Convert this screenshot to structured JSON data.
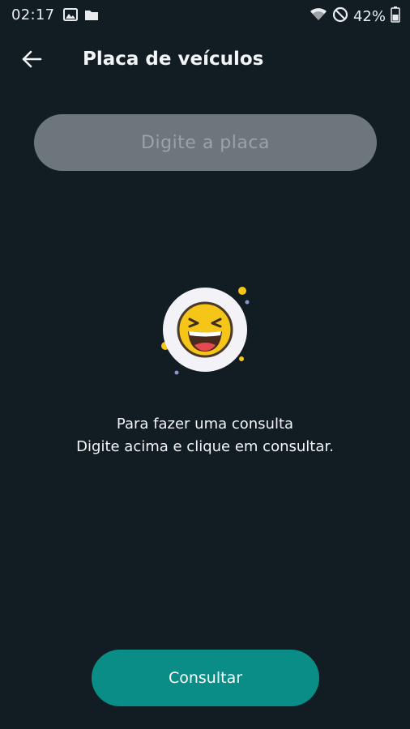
{
  "status_bar": {
    "time": "02:17",
    "battery": "42%",
    "icons": [
      "image-icon",
      "folder-icon",
      "wifi-icon",
      "do-not-disturb-icon",
      "battery-icon"
    ]
  },
  "app_bar": {
    "title": "Placa de veículos",
    "back_icon": "arrow-left-icon"
  },
  "search": {
    "placeholder": "Digite a placa",
    "value": ""
  },
  "empty_state": {
    "icon": "laughing-emoji-icon",
    "line1": "Para fazer uma consulta",
    "line2": "Digite acima e clique em consultar."
  },
  "actions": {
    "consult_label": "Consultar"
  },
  "colors": {
    "background": "#121d23",
    "input_background": "#6c767c",
    "accent": "#0b8d87",
    "emoji_yellow": "#f5c518"
  }
}
